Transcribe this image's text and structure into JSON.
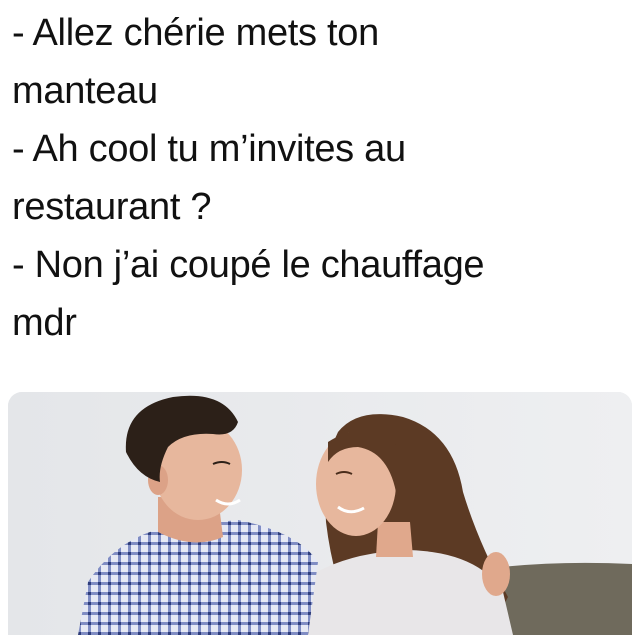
{
  "meme": {
    "lines": [
      "- Allez chérie mets ton",
      "manteau",
      "- Ah cool tu m’invites au",
      "restaurant ?",
      "- Non j’ai coupé le chauffage",
      "mdr"
    ]
  },
  "photo": {
    "subject": "man-and-woman-on-sofa-photo",
    "colors": {
      "background": "#e9eaec",
      "sofa": "#6f6a5c",
      "shirt_check": "#5d6fb4",
      "woman_top": "#e8e6e8",
      "woman_hair": "#5c3a24",
      "man_hair": "#2c2018",
      "skin": "#e7b79d"
    }
  }
}
